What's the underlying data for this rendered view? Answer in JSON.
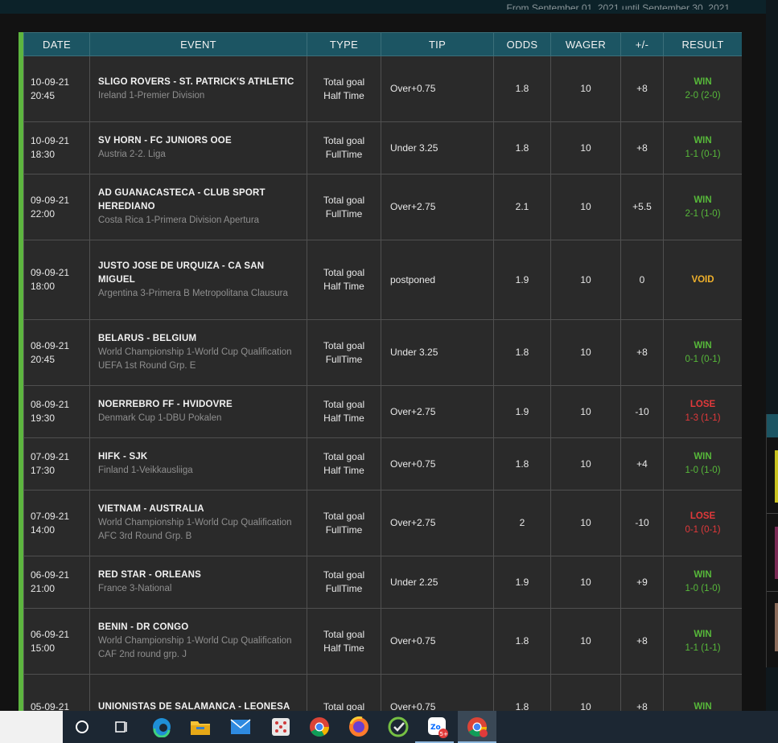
{
  "header": {
    "caption": "From September 01, 2021 until September 30, 2021"
  },
  "table": {
    "columns": [
      "DATE",
      "EVENT",
      "TYPE",
      "TIP",
      "ODDS",
      "WAGER",
      "+/-",
      "RESULT"
    ],
    "rows": [
      {
        "date": "10-09-21",
        "time": "20:45",
        "event": "SLIGO ROVERS - ST. PATRICK'S ATHLETIC",
        "league": "Ireland 1-Premier Division",
        "type_line1": "Total goal",
        "type_line2": "Half Time",
        "tip": "Over+0.75",
        "odds": "1.8",
        "wager": "10",
        "profit": "+8",
        "result": "WIN",
        "score": "2-0 (2-0)",
        "status": "win"
      },
      {
        "date": "10-09-21",
        "time": "18:30",
        "event": "SV HORN - FC JUNIORS OOE",
        "league": "Austria 2-2. Liga",
        "type_line1": "Total goal",
        "type_line2": "FullTime",
        "tip": "Under 3.25",
        "odds": "1.8",
        "wager": "10",
        "profit": "+8",
        "result": "WIN",
        "score": "1-1 (0-1)",
        "status": "win"
      },
      {
        "date": "09-09-21",
        "time": "22:00",
        "event": "AD GUANACASTECA - CLUB SPORT HEREDIANO",
        "league": "Costa Rica 1-Primera Division Apertura",
        "type_line1": "Total goal",
        "type_line2": "FullTime",
        "tip": "Over+2.75",
        "odds": "2.1",
        "wager": "10",
        "profit": "+5.5",
        "result": "WIN",
        "score": "2-1 (1-0)",
        "status": "win"
      },
      {
        "date": "09-09-21",
        "time": "18:00",
        "event": "JUSTO JOSE DE URQUIZA - CA SAN MIGUEL",
        "league": "Argentina 3-Primera B Metropolitana Clausura",
        "type_line1": "Total goal",
        "type_line2": "Half Time",
        "tip": "postponed",
        "odds": "1.9",
        "wager": "10",
        "profit": "0",
        "result": "VOID",
        "score": "",
        "status": "void"
      },
      {
        "date": "08-09-21",
        "time": "20:45",
        "event": "BELARUS - BELGIUM",
        "league": "World Championship 1-World Cup Qualification UEFA 1st Round Grp. E",
        "type_line1": "Total goal",
        "type_line2": "FullTime",
        "tip": "Under 3.25",
        "odds": "1.8",
        "wager": "10",
        "profit": "+8",
        "result": "WIN",
        "score": "0-1 (0-1)",
        "status": "win"
      },
      {
        "date": "08-09-21",
        "time": "19:30",
        "event": "NOERREBRO FF - HVIDOVRE",
        "league": "Denmark Cup 1-DBU Pokalen",
        "type_line1": "Total goal",
        "type_line2": "Half Time",
        "tip": "Over+2.75",
        "odds": "1.9",
        "wager": "10",
        "profit": "-10",
        "result": "LOSE",
        "score": "1-3 (1-1)",
        "status": "lose"
      },
      {
        "date": "07-09-21",
        "time": "17:30",
        "event": "HIFK - SJK",
        "league": "Finland 1-Veikkausliiga",
        "type_line1": "Total goal",
        "type_line2": "Half Time",
        "tip": "Over+0.75",
        "odds": "1.8",
        "wager": "10",
        "profit": "+4",
        "result": "WIN",
        "score": "1-0 (1-0)",
        "status": "win"
      },
      {
        "date": "07-09-21",
        "time": "14:00",
        "event": "VIETNAM - AUSTRALIA",
        "league": "World Championship 1-World Cup Qualification AFC 3rd Round Grp. B",
        "type_line1": "Total goal",
        "type_line2": "FullTime",
        "tip": "Over+2.75",
        "odds": "2",
        "wager": "10",
        "profit": "-10",
        "result": "LOSE",
        "score": "0-1 (0-1)",
        "status": "lose"
      },
      {
        "date": "06-09-21",
        "time": "21:00",
        "event": "RED STAR - ORLEANS",
        "league": "France 3-National",
        "type_line1": "Total goal",
        "type_line2": "FullTime",
        "tip": "Under 2.25",
        "odds": "1.9",
        "wager": "10",
        "profit": "+9",
        "result": "WIN",
        "score": "1-0 (1-0)",
        "status": "win"
      },
      {
        "date": "06-09-21",
        "time": "15:00",
        "event": "BENIN - DR CONGO",
        "league": "World Championship 1-World Cup Qualification CAF 2nd round grp. J",
        "type_line1": "Total goal",
        "type_line2": "Half Time",
        "tip": "Over+0.75",
        "odds": "1.8",
        "wager": "10",
        "profit": "+8",
        "result": "WIN",
        "score": "1-1 (1-1)",
        "status": "win"
      },
      {
        "date": "05-09-21",
        "time": "",
        "event": "UNIONISTAS DE SALAMANCA - LEONESA",
        "league": "",
        "type_line1": "Total goal",
        "type_line2": "",
        "tip": "Over+0.75",
        "odds": "1.8",
        "wager": "10",
        "profit": "+8",
        "result": "WIN",
        "score": "",
        "status": "win"
      }
    ]
  },
  "taskbar": {
    "chrome_badge": "5+",
    "icons": [
      "search-icon",
      "task-view-icon",
      "edge-icon",
      "file-explorer-icon",
      "mail-icon",
      "dice-app-icon",
      "chrome-icon",
      "firefox-icon",
      "ccleaner-icon",
      "chrome-canary-icon",
      "chrome-active-icon"
    ]
  }
}
